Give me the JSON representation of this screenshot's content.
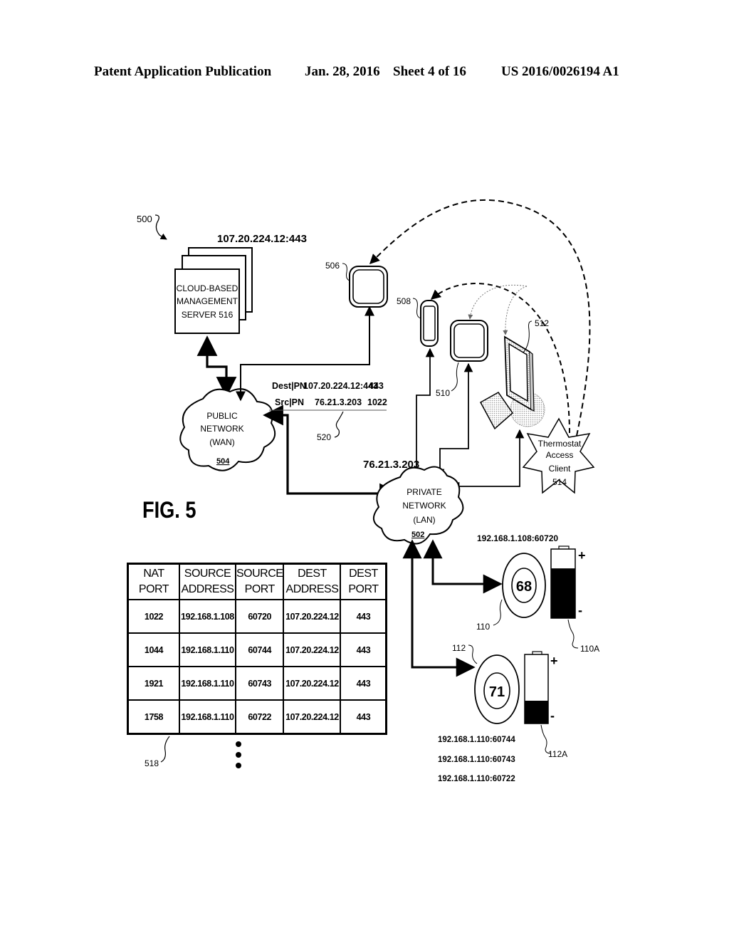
{
  "header": {
    "publication": "Patent Application Publication",
    "date": "Jan. 28, 2016",
    "sheet": "Sheet 4 of 16",
    "number": "US 2016/0026194 A1"
  },
  "figure": {
    "label": "FIG. 5",
    "ref_system": "500"
  },
  "server": {
    "address": "107.20.224.12:443",
    "lines": [
      "CLOUD-BASED",
      "MANAGEMENT",
      "SERVER 516"
    ]
  },
  "public_network": {
    "lines": [
      "PUBLIC",
      "NETWORK",
      "(WAN)"
    ],
    "ref": "504"
  },
  "private_network": {
    "address": "76.21.3.203",
    "lines": [
      "PRIVATE",
      "NETWORK",
      "(LAN)"
    ],
    "ref": "502"
  },
  "packet": {
    "dest_label": "Dest|PN",
    "dest_address": "107.20.224.12:443",
    "dest_port": "443",
    "src_label": "Src|PN",
    "src_address": "76.21.3.203",
    "src_port": "1022",
    "ref": "520"
  },
  "devices": {
    "ref_506": "506",
    "ref_508": "508",
    "ref_510": "510",
    "ref_512": "512"
  },
  "access_client": {
    "lines": [
      "Thermostat",
      "Access",
      "Client",
      "514"
    ]
  },
  "thermostats": [
    {
      "ref": "110",
      "temperature": "68",
      "address": "192.168.1.108:60720",
      "battery_ref": "110A",
      "battery_level": 0.72
    },
    {
      "ref": "112",
      "temperature": "71",
      "address_lines": [
        "192.168.1.110:60744",
        "192.168.1.110:60743",
        "192.168.1.110:60722"
      ],
      "battery_ref": "112A",
      "battery_level": 0.33
    }
  ],
  "battery_symbols": {
    "plus": "+",
    "minus": "-"
  },
  "nat_table": {
    "ref": "518",
    "columns": [
      [
        "NAT",
        "PORT"
      ],
      [
        "SOURCE",
        "ADDRESS"
      ],
      [
        "SOURCE",
        "PORT"
      ],
      [
        "DEST",
        "ADDRESS"
      ],
      [
        "DEST",
        "PORT"
      ]
    ],
    "rows": [
      [
        "1022",
        "192.168.1.108",
        "60720",
        "107.20.224.12",
        "443"
      ],
      [
        "1044",
        "192.168.1.110",
        "60744",
        "107.20.224.12",
        "443"
      ],
      [
        "1921",
        "192.168.1.110",
        "60743",
        "107.20.224.12",
        "443"
      ],
      [
        "1758",
        "192.168.1.110",
        "60722",
        "107.20.224.12",
        "443"
      ]
    ],
    "continuation": "⋮"
  }
}
